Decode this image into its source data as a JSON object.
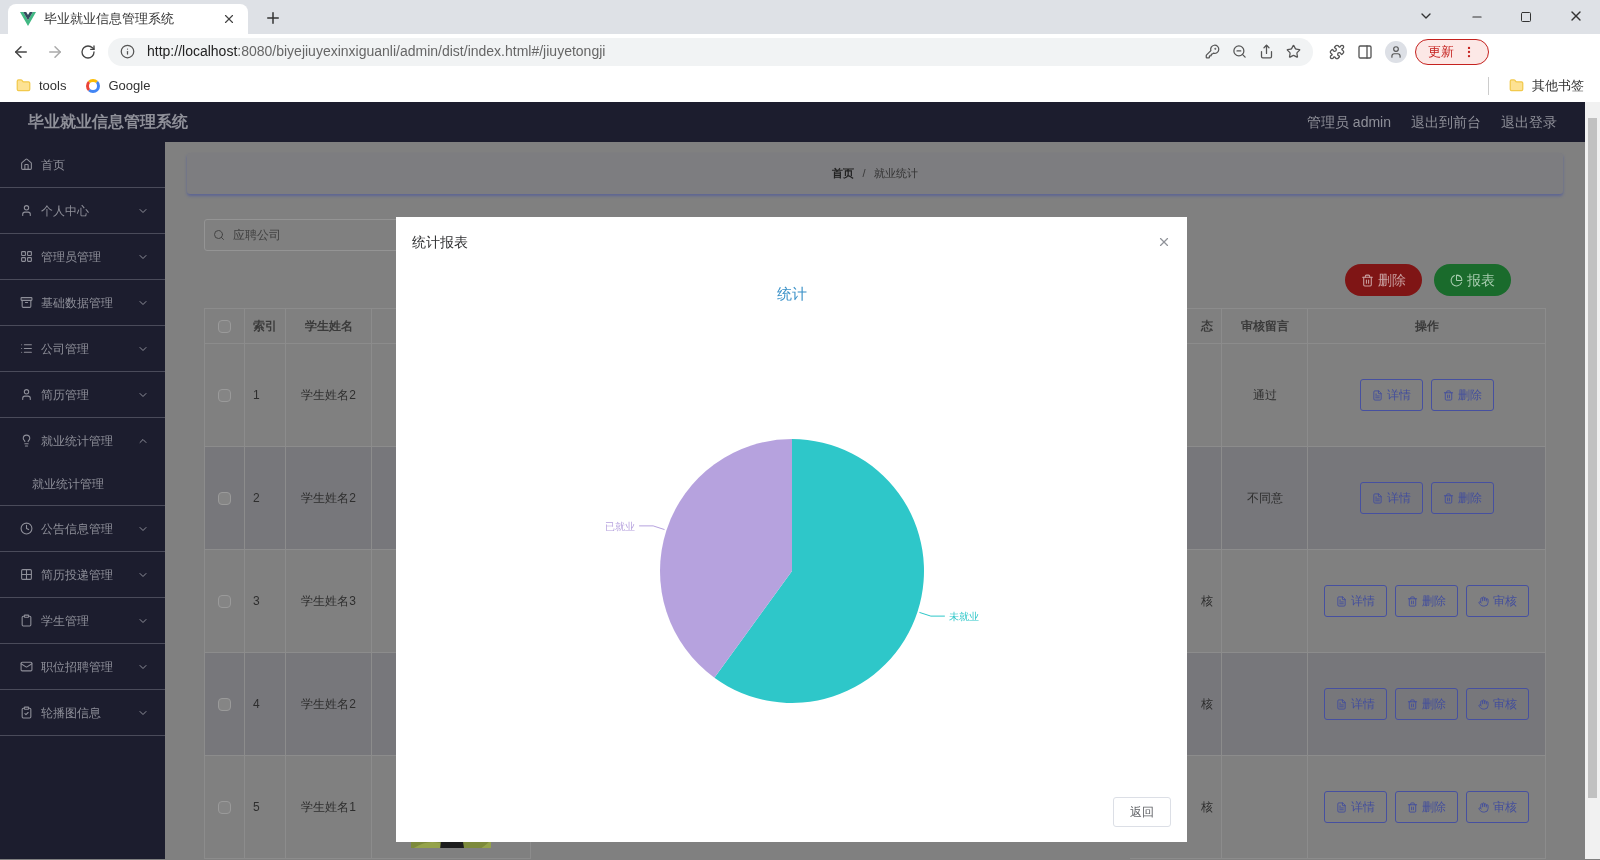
{
  "browser": {
    "tab_title": "毕业就业信息管理系统",
    "url_host": "http://localhost",
    "url_rest": ":8080/biyejiuyexinxiguanli/admin/dist/index.html#/jiuyetongji",
    "bookmarks": [
      {
        "label": "tools",
        "kind": "folder"
      },
      {
        "label": "Google",
        "kind": "google"
      }
    ],
    "other_bookmarks": "其他书签",
    "update_button": "更新"
  },
  "app": {
    "title": "毕业就业信息管理系统",
    "header_links": [
      "管理员 admin",
      "退出到前台",
      "退出登录"
    ]
  },
  "sidebar": {
    "items": [
      {
        "label": "首页",
        "kind": "link"
      },
      {
        "label": "个人中心",
        "kind": "menu",
        "expanded": false
      },
      {
        "label": "管理员管理",
        "kind": "menu",
        "expanded": false
      },
      {
        "label": "基础数据管理",
        "kind": "menu",
        "expanded": false
      },
      {
        "label": "公司管理",
        "kind": "menu",
        "expanded": false
      },
      {
        "label": "简历管理",
        "kind": "menu",
        "expanded": false
      },
      {
        "label": "就业统计管理",
        "kind": "menu",
        "expanded": true,
        "children": [
          {
            "label": "就业统计管理"
          }
        ]
      },
      {
        "label": "公告信息管理",
        "kind": "menu",
        "expanded": false
      },
      {
        "label": "简历投递管理",
        "kind": "menu",
        "expanded": false
      },
      {
        "label": "学生管理",
        "kind": "menu",
        "expanded": false
      },
      {
        "label": "职位招聘管理",
        "kind": "menu",
        "expanded": false
      },
      {
        "label": "轮播图信息",
        "kind": "menu",
        "expanded": false
      }
    ]
  },
  "breadcrumb": {
    "items": [
      "首页",
      "就业统计"
    ],
    "separator": "/"
  },
  "search": {
    "placeholder": "应聘公司"
  },
  "toolbar": [
    {
      "label": "删除",
      "kind": "danger"
    },
    {
      "label": "报表",
      "kind": "chart"
    }
  ],
  "table": {
    "all_checked": false,
    "columns": {
      "index": "索引",
      "student": "学生姓名",
      "column_status": "态",
      "review_note": "审核留言",
      "actions": "操作"
    },
    "rows": [
      {
        "checked": false,
        "index": "1",
        "student": "学生姓名2",
        "status": "",
        "review_note": "通过",
        "actions": [
          {
            "label": "详情",
            "kind": "detail"
          },
          {
            "label": "删除",
            "kind": "delete"
          }
        ]
      },
      {
        "checked": false,
        "index": "2",
        "student": "学生姓名2",
        "status": "",
        "review_note": "不同意",
        "actions": [
          {
            "label": "详情",
            "kind": "detail"
          },
          {
            "label": "删除",
            "kind": "delete"
          }
        ]
      },
      {
        "checked": false,
        "index": "3",
        "student": "学生姓名3",
        "status": "核",
        "review_note": "",
        "actions": [
          {
            "label": "详情",
            "kind": "detail"
          },
          {
            "label": "删除",
            "kind": "delete"
          },
          {
            "label": "审核",
            "kind": "review"
          }
        ]
      },
      {
        "checked": false,
        "index": "4",
        "student": "学生姓名2",
        "status": "核",
        "review_note": "",
        "actions": [
          {
            "label": "详情",
            "kind": "detail"
          },
          {
            "label": "删除",
            "kind": "delete"
          },
          {
            "label": "审核",
            "kind": "review"
          }
        ]
      },
      {
        "checked": false,
        "index": "5",
        "student": "学生姓名1",
        "status": "核",
        "review_note": "",
        "actions": [
          {
            "label": "详情",
            "kind": "detail"
          },
          {
            "label": "删除",
            "kind": "delete"
          },
          {
            "label": "审核",
            "kind": "review"
          }
        ]
      }
    ]
  },
  "modal": {
    "title": "统计报表",
    "chart_data": {
      "type": "pie",
      "title": "统计",
      "categories": [
        "未就业",
        "已就业"
      ],
      "colors": [
        "#2ec7c9",
        "#b6a2de"
      ],
      "values": [
        60,
        40
      ]
    },
    "button": "返回"
  }
}
